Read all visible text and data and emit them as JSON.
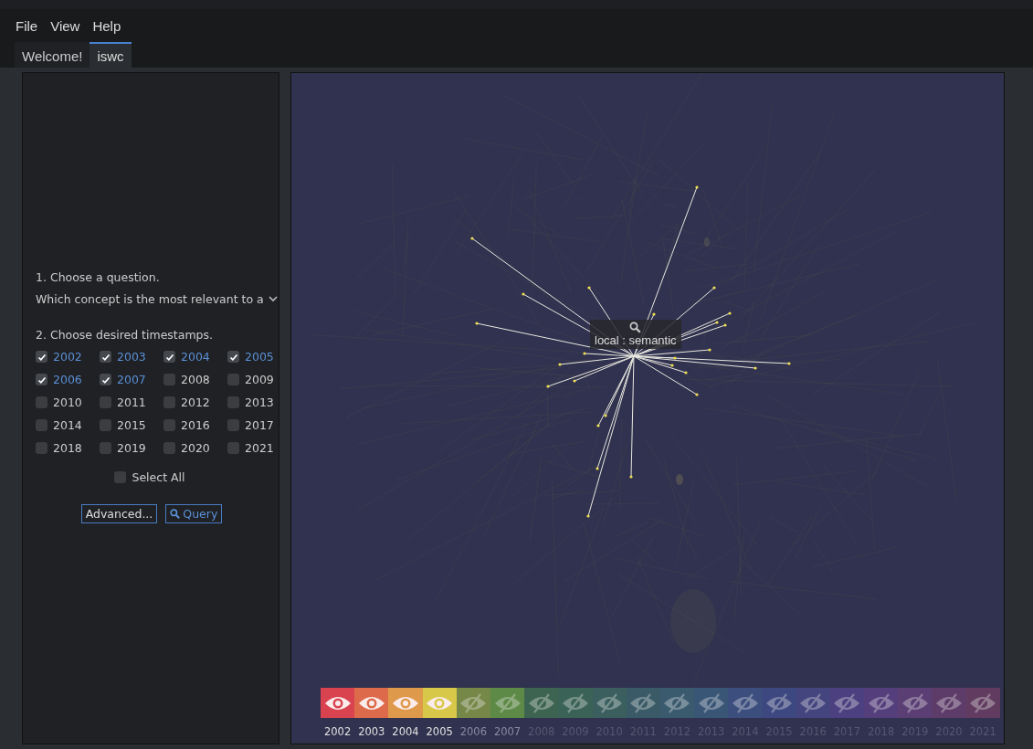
{
  "menu": [
    "File",
    "View",
    "Help"
  ],
  "tabs": [
    {
      "label": "Welcome!",
      "selected": false
    },
    {
      "label": "iswc",
      "selected": true
    }
  ],
  "sidebar": {
    "question_label": "1. Choose a question.",
    "question_value": "Which concept is the most relevant to a",
    "timestamps_label": "2. Choose desired timestamps.",
    "timestamps": [
      {
        "year": "2002",
        "checked": true
      },
      {
        "year": "2003",
        "checked": true
      },
      {
        "year": "2004",
        "checked": true
      },
      {
        "year": "2005",
        "checked": true
      },
      {
        "year": "2006",
        "checked": true
      },
      {
        "year": "2007",
        "checked": true
      },
      {
        "year": "2008",
        "checked": false
      },
      {
        "year": "2009",
        "checked": false
      },
      {
        "year": "2010",
        "checked": false
      },
      {
        "year": "2011",
        "checked": false
      },
      {
        "year": "2012",
        "checked": false
      },
      {
        "year": "2013",
        "checked": false
      },
      {
        "year": "2014",
        "checked": false
      },
      {
        "year": "2015",
        "checked": false
      },
      {
        "year": "2016",
        "checked": false
      },
      {
        "year": "2017",
        "checked": false
      },
      {
        "year": "2018",
        "checked": false
      },
      {
        "year": "2019",
        "checked": false
      },
      {
        "year": "2020",
        "checked": false
      },
      {
        "year": "2021",
        "checked": false
      }
    ],
    "select_all": {
      "label": "Select All",
      "checked": false
    },
    "buttons": [
      "Advanced...",
      "Query"
    ]
  },
  "graph": {
    "tooltip": "local : semantic",
    "timeline": [
      {
        "year": "2002",
        "color": "#d9434f",
        "visible": true,
        "in_query": true
      },
      {
        "year": "2003",
        "color": "#dd6a4b",
        "visible": true,
        "in_query": true
      },
      {
        "year": "2004",
        "color": "#df994b",
        "visible": true,
        "in_query": true
      },
      {
        "year": "2005",
        "color": "#d8c84a",
        "visible": true,
        "in_query": true
      },
      {
        "year": "2006",
        "color": "#768848",
        "visible": false,
        "in_query": true
      },
      {
        "year": "2007",
        "color": "#5e8a47",
        "visible": false,
        "in_query": true
      },
      {
        "year": "2008",
        "color": "#3d6450",
        "visible": false,
        "in_query": false
      },
      {
        "year": "2009",
        "color": "#3b6256",
        "visible": false,
        "in_query": false
      },
      {
        "year": "2010",
        "color": "#3a5f5e",
        "visible": false,
        "in_query": false
      },
      {
        "year": "2011",
        "color": "#395a66",
        "visible": false,
        "in_query": false
      },
      {
        "year": "2012",
        "color": "#3a5a6e",
        "visible": false,
        "in_query": false
      },
      {
        "year": "2013",
        "color": "#3a5676",
        "visible": false,
        "in_query": false
      },
      {
        "year": "2014",
        "color": "#3c4e7e",
        "visible": false,
        "in_query": false
      },
      {
        "year": "2015",
        "color": "#3e4880",
        "visible": false,
        "in_query": false
      },
      {
        "year": "2016",
        "color": "#44447e",
        "visible": false,
        "in_query": false
      },
      {
        "year": "2017",
        "color": "#4c4080",
        "visible": false,
        "in_query": false
      },
      {
        "year": "2018",
        "color": "#553e7c",
        "visible": false,
        "in_query": false
      },
      {
        "year": "2019",
        "color": "#5a3e74",
        "visible": false,
        "in_query": false
      },
      {
        "year": "2020",
        "color": "#5e3c6a",
        "visible": false,
        "in_query": false
      },
      {
        "year": "2021",
        "color": "#613c60",
        "visible": false,
        "in_query": false
      }
    ]
  }
}
